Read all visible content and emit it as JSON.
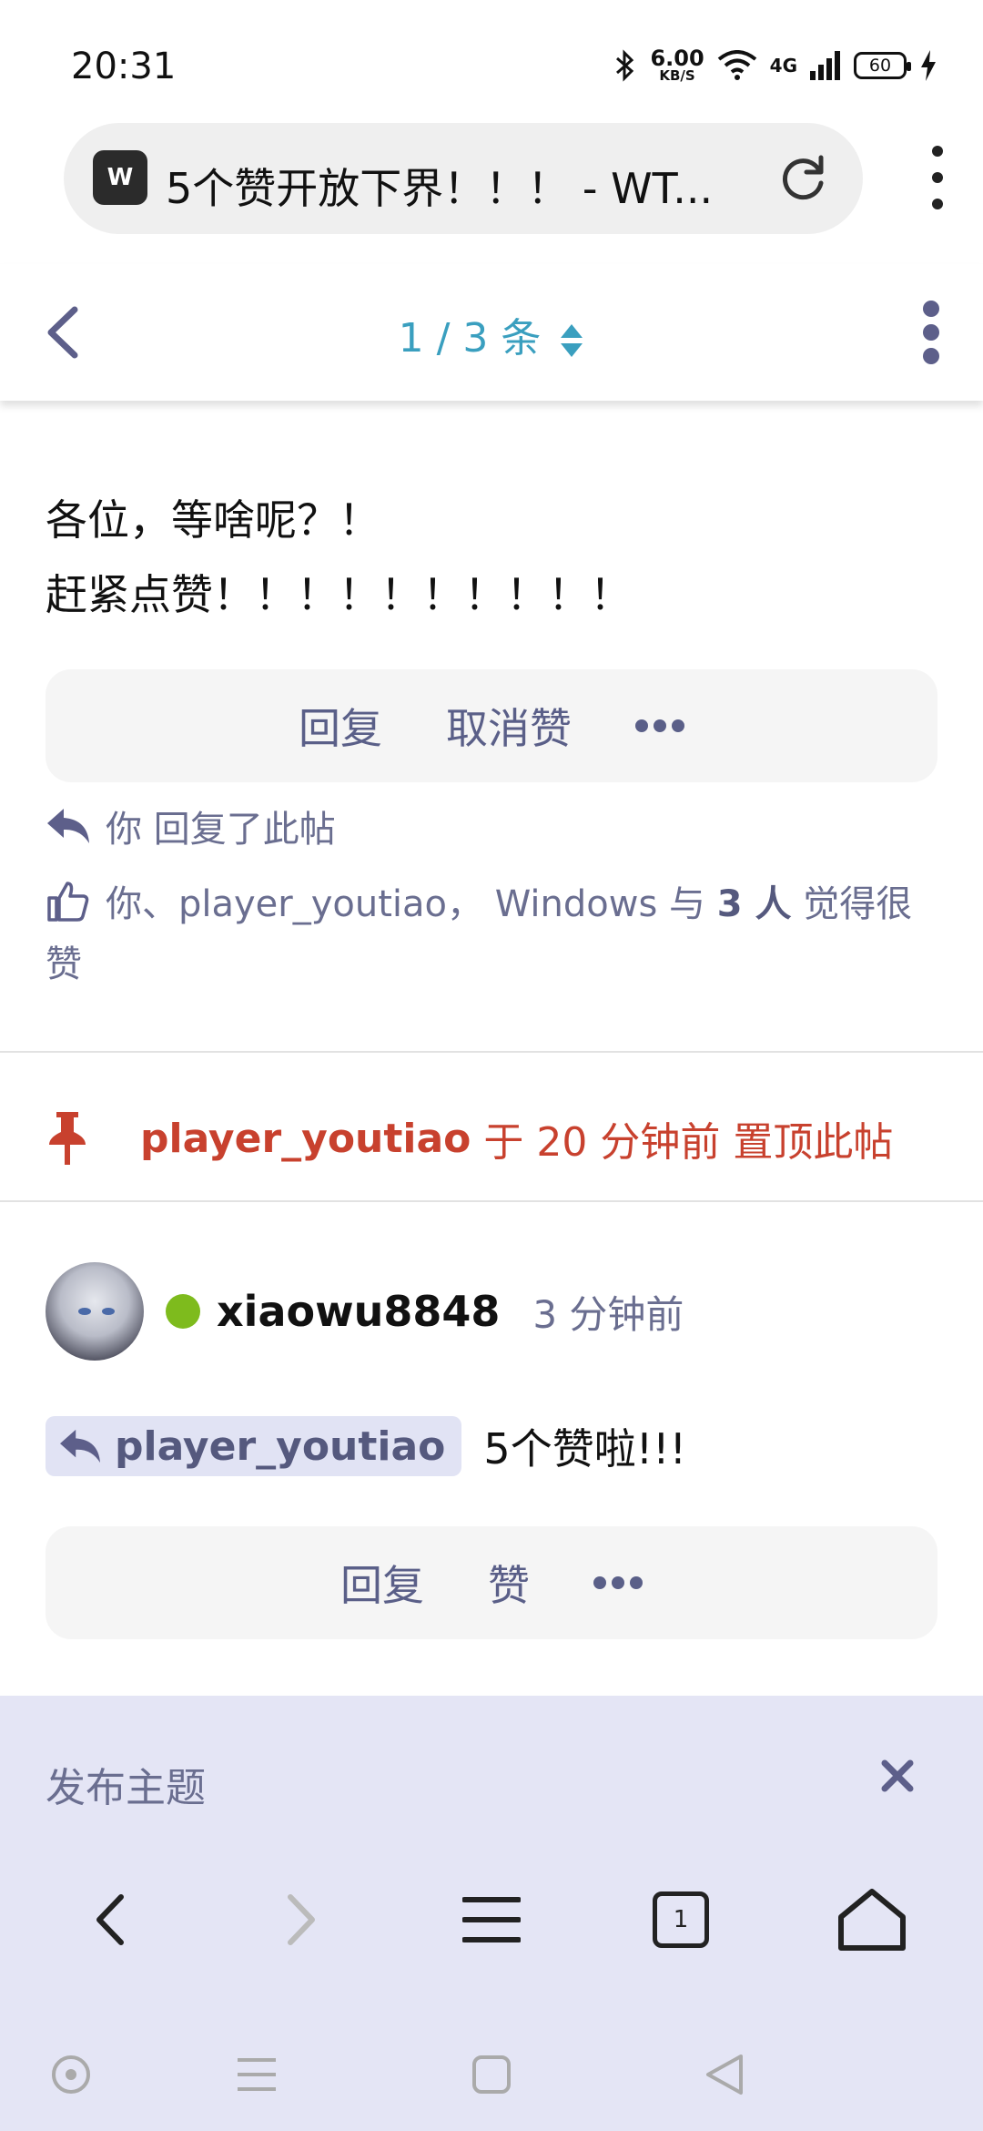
{
  "status_bar": {
    "time": "20:31",
    "net_speed_value": "6.00",
    "net_speed_unit": "KB/S",
    "network_type": "4G",
    "battery": "60",
    "icons": [
      "bluetooth-icon",
      "wifi-icon",
      "signal-icon",
      "battery-icon",
      "charging-icon"
    ]
  },
  "browser": {
    "tab_title": "5个赞开放下界！！！ - WT...",
    "logo_text": "W"
  },
  "topic_header": {
    "counter": "1 / 3 条"
  },
  "first_post": {
    "line1": "各位，等啥呢？！",
    "line2": "赶紧点赞！！！！！！！！！！",
    "actions": {
      "reply": "回复",
      "unlike": "取消赞"
    },
    "replied_note": "你 回复了此帖",
    "likes_prefix": "你、player_youtiao， Windows 与 ",
    "likes_count": "3 人",
    "likes_suffix": " 觉得很赞"
  },
  "pinned": {
    "user": "player_youtiao",
    "text": "于 20 分钟前 置顶此帖"
  },
  "reply_post": {
    "username": "xiaowu8848",
    "time": "3 分钟前",
    "reply_to": "player_youtiao",
    "text": "5个赞啦!!!",
    "actions": {
      "reply": "回复",
      "like": "赞"
    }
  },
  "composer": {
    "title": "发布主题"
  },
  "browser_nav": {
    "tab_count": "1"
  },
  "colors": {
    "accent": "#3a9fbf",
    "muted": "#6a6e90",
    "pinned_red": "#c8412e",
    "online_green": "#7ebb1d",
    "composer_bg": "#e4e5f5"
  }
}
